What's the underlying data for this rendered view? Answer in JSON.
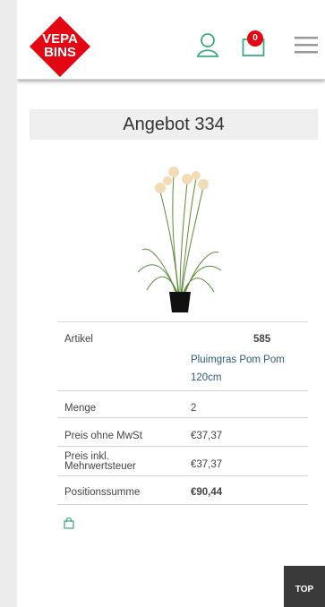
{
  "header": {
    "logo_line1": "VEPA",
    "logo_line2": "BINS",
    "cart_count": "0",
    "brand_color": "#e30613",
    "icon_color": "#3dab7f",
    "user_icon": "user-icon",
    "cart_icon": "cart-icon",
    "menu_icon": "hamburger-menu-icon"
  },
  "page_title": "Angebot 334",
  "product": {
    "image_description": "product-photo",
    "rows": [
      {
        "label": "Artikel",
        "article_number": "585",
        "name": "Pluimgras Pom Pom 120cm"
      },
      {
        "label": "Menge",
        "value": "2"
      },
      {
        "label_line1": "Preis ohne MwSt",
        "value": "€37,37"
      },
      {
        "label_line1": "Preis inkl.",
        "label_line2": "Mehrwertsteuer",
        "value": "€37,37"
      },
      {
        "label_line1": "Positionssumme",
        "value": "€90,44"
      }
    ]
  },
  "footer": {
    "top_label": "TOP"
  }
}
